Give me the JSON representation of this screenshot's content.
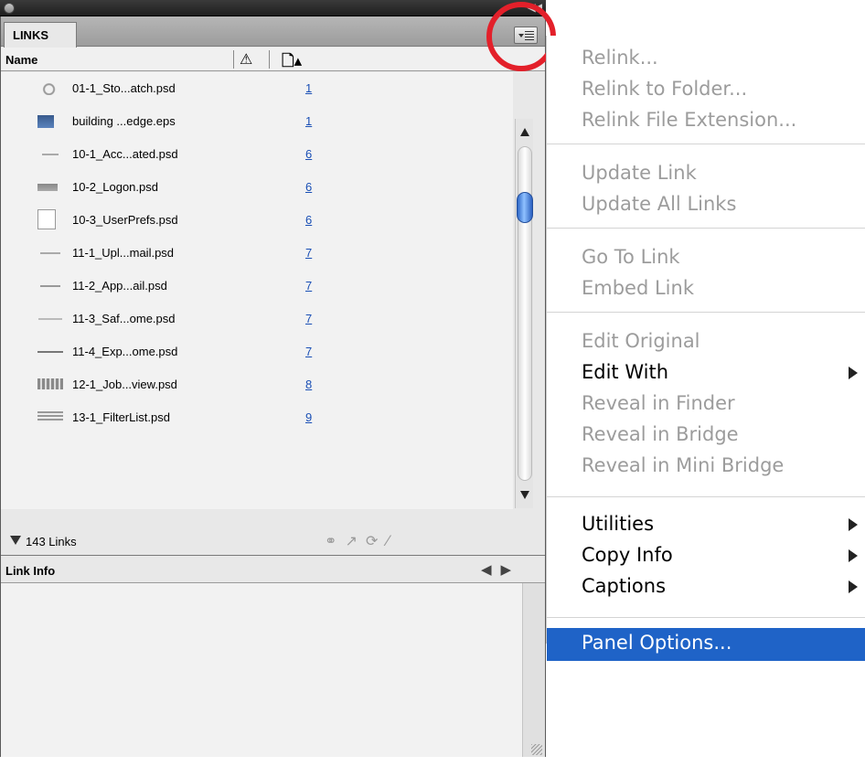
{
  "panel": {
    "tab_label": "LINKS",
    "columns": {
      "name": "Name"
    },
    "links": [
      {
        "name": "01-1_Sto...atch.psd",
        "page": "1"
      },
      {
        "name": "building ...edge.eps",
        "page": "1"
      },
      {
        "name": "10-1_Acc...ated.psd",
        "page": "6"
      },
      {
        "name": "10-2_Logon.psd",
        "page": "6"
      },
      {
        "name": "10-3_UserPrefs.psd",
        "page": "6"
      },
      {
        "name": "11-1_Upl...mail.psd",
        "page": "7"
      },
      {
        "name": "11-2_App...ail.psd",
        "page": "7"
      },
      {
        "name": "11-3_Saf...ome.psd",
        "page": "7"
      },
      {
        "name": "11-4_Exp...ome.psd",
        "page": "7"
      },
      {
        "name": "12-1_Job...view.psd",
        "page": "8"
      },
      {
        "name": "13-1_FilterList.psd",
        "page": "9"
      }
    ],
    "status": {
      "count_label": "143 Links"
    },
    "link_info_label": "Link Info"
  },
  "menu": {
    "items": [
      {
        "label": "Relink...",
        "enabled": false
      },
      {
        "label": "Relink to Folder...",
        "enabled": false
      },
      {
        "label": "Relink File Extension...",
        "enabled": false
      },
      {
        "label": "Update Link",
        "enabled": false
      },
      {
        "label": "Update All Links",
        "enabled": false
      },
      {
        "label": "Go To Link",
        "enabled": false
      },
      {
        "label": "Embed Link",
        "enabled": false
      },
      {
        "label": "Edit Original",
        "enabled": false
      },
      {
        "label": "Edit With",
        "enabled": true,
        "submenu": true
      },
      {
        "label": "Reveal in Finder",
        "enabled": false
      },
      {
        "label": "Reveal in Bridge",
        "enabled": false
      },
      {
        "label": "Reveal in Mini Bridge",
        "enabled": false
      },
      {
        "label": "Utilities",
        "enabled": true,
        "submenu": true
      },
      {
        "label": "Copy Info",
        "enabled": true,
        "submenu": true
      },
      {
        "label": "Captions",
        "enabled": true,
        "submenu": true
      },
      {
        "label": "Panel Options...",
        "enabled": true,
        "highlighted": true
      }
    ]
  },
  "colors": {
    "highlight": "#1f63c7",
    "annotation_circle": "#e3202a",
    "page_link": "#1a4fb5"
  }
}
